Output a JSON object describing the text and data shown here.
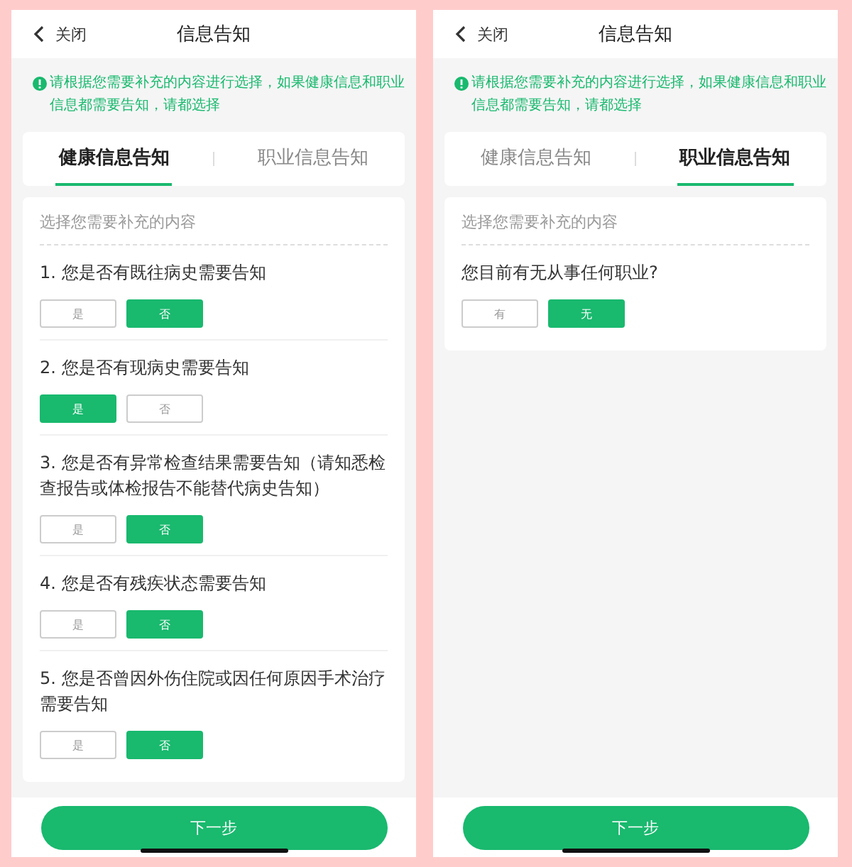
{
  "screens": [
    {
      "header": {
        "back_label": "关闭",
        "title": "信息告知"
      },
      "notice": "请根据您需要补充的内容进行选择，如果健康信息和职业信息都需要告知，请都选择",
      "tabs": [
        {
          "label": "健康信息告知",
          "selected": true
        },
        {
          "label": "职业信息告知",
          "selected": false
        }
      ],
      "prompt": "选择您需要补充的内容",
      "questions": [
        {
          "text": "1. 您是否有既往病史需要告知",
          "options": [
            {
              "label": "是",
              "selected": false
            },
            {
              "label": "否",
              "selected": true
            }
          ]
        },
        {
          "text": "2. 您是否有现病史需要告知",
          "options": [
            {
              "label": "是",
              "selected": true
            },
            {
              "label": "否",
              "selected": false
            }
          ]
        },
        {
          "text": "3. 您是否有异常检查结果需要告知（请知悉检查报告或体检报告不能替代病史告知）",
          "options": [
            {
              "label": "是",
              "selected": false
            },
            {
              "label": "否",
              "selected": true
            }
          ]
        },
        {
          "text": "4. 您是否有残疾状态需要告知",
          "options": [
            {
              "label": "是",
              "selected": false
            },
            {
              "label": "否",
              "selected": true
            }
          ]
        },
        {
          "text": "5. 您是否曾因外伤住院或因任何原因手术治疗需要告知",
          "options": [
            {
              "label": "是",
              "selected": false
            },
            {
              "label": "否",
              "selected": true
            }
          ]
        }
      ],
      "next_button": "下一步"
    },
    {
      "header": {
        "back_label": "关闭",
        "title": "信息告知"
      },
      "notice": "请根据您需要补充的内容进行选择，如果健康信息和职业信息都需要告知，请都选择",
      "tabs": [
        {
          "label": "健康信息告知",
          "selected": false
        },
        {
          "label": "职业信息告知",
          "selected": true
        }
      ],
      "prompt": "选择您需要补充的内容",
      "questions": [
        {
          "text": "您目前有无从事任何职业?",
          "options": [
            {
              "label": "有",
              "selected": false
            },
            {
              "label": "无",
              "selected": true
            }
          ]
        }
      ],
      "next_button": "下一步"
    }
  ]
}
